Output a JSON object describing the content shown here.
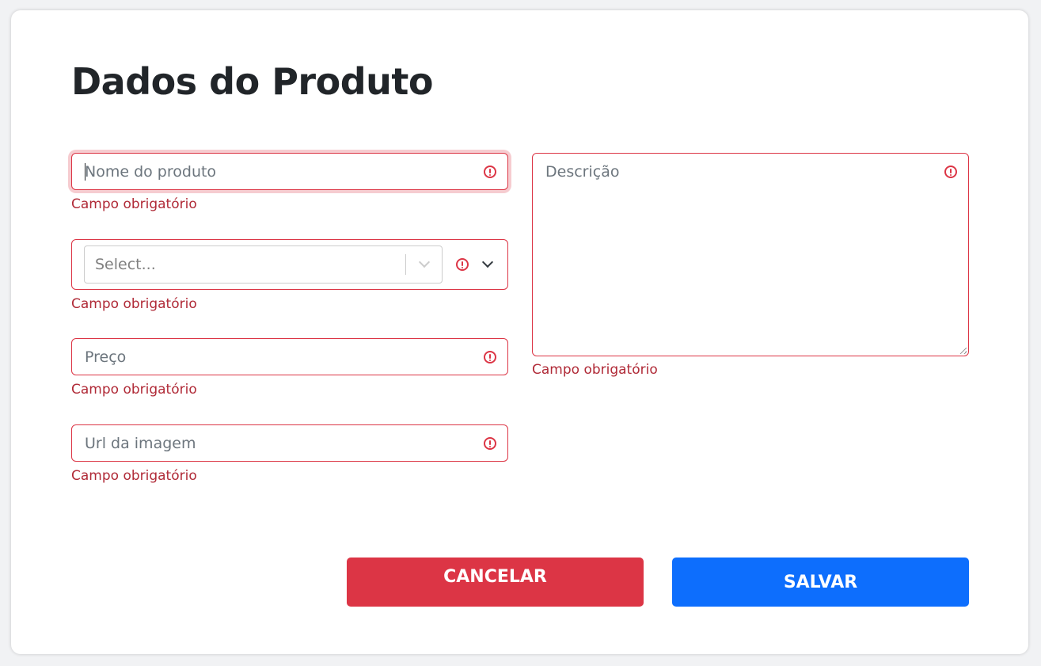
{
  "form": {
    "title": "Dados do Produto",
    "fields": {
      "name": {
        "placeholder": "Nome do produto",
        "value": "",
        "error": "Campo obrigatório",
        "focused": true
      },
      "category": {
        "placeholder": "Select...",
        "selected": "",
        "error": "Campo obrigatório"
      },
      "price": {
        "placeholder": "Preço",
        "value": "",
        "error": "Campo obrigatório"
      },
      "image_url": {
        "placeholder": "Url da imagem",
        "value": "",
        "error": "Campo obrigatório"
      },
      "description": {
        "placeholder": "Descrição",
        "value": "",
        "error": "Campo obrigatório"
      }
    },
    "buttons": {
      "cancel_label": "CANCELAR",
      "save_label": "SALVAR"
    }
  },
  "colors": {
    "error": "#dc3545",
    "error_text": "#b02a37",
    "primary": "#0d6efd",
    "title": "#212529",
    "placeholder": "#6c757d"
  },
  "icons": {
    "error": "exclamation-circle-icon",
    "dropdown": "chevron-down-icon"
  }
}
